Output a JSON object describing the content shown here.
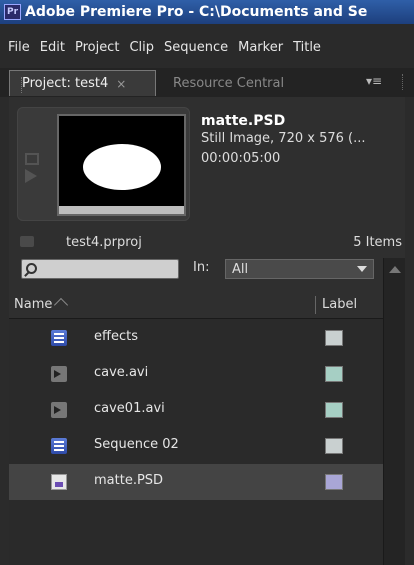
{
  "window": {
    "logo_text": "Pr",
    "title": "Adobe Premiere Pro - C:\\Documents and Se"
  },
  "menu": [
    "File",
    "Edit",
    "Project",
    "Clip",
    "Sequence",
    "Marker",
    "Title"
  ],
  "tabs": {
    "active": "Project: test4",
    "active_close": "×",
    "inactive": "Resource Central",
    "menu_glyph": "▾≡"
  },
  "preview": {
    "clip_name": "matte.PSD",
    "clip_info": "Still Image, 720 x 576 (...",
    "duration": "00:00:05:00"
  },
  "project": {
    "name": "test4.prproj",
    "item_count": "5 Items"
  },
  "search": {
    "value": "",
    "in_label": "In:",
    "in_value": "All"
  },
  "columns": {
    "name": "Name",
    "label": "Label"
  },
  "items": [
    {
      "name": "effects",
      "icon": "sequence-icon",
      "label_color": "#c9d0d0"
    },
    {
      "name": "cave.avi",
      "icon": "video-icon",
      "label_color": "#a6cfc4"
    },
    {
      "name": "cave01.avi",
      "icon": "video-icon",
      "label_color": "#a6cfc4"
    },
    {
      "name": "Sequence 02",
      "icon": "sequence-icon",
      "label_color": "#c9d0d0"
    },
    {
      "name": "matte.PSD",
      "icon": "still-image-icon",
      "label_color": "#a9a6d6"
    }
  ],
  "colors": {
    "title_bar": "#2f5fa8",
    "background": "#2b2b2b"
  }
}
